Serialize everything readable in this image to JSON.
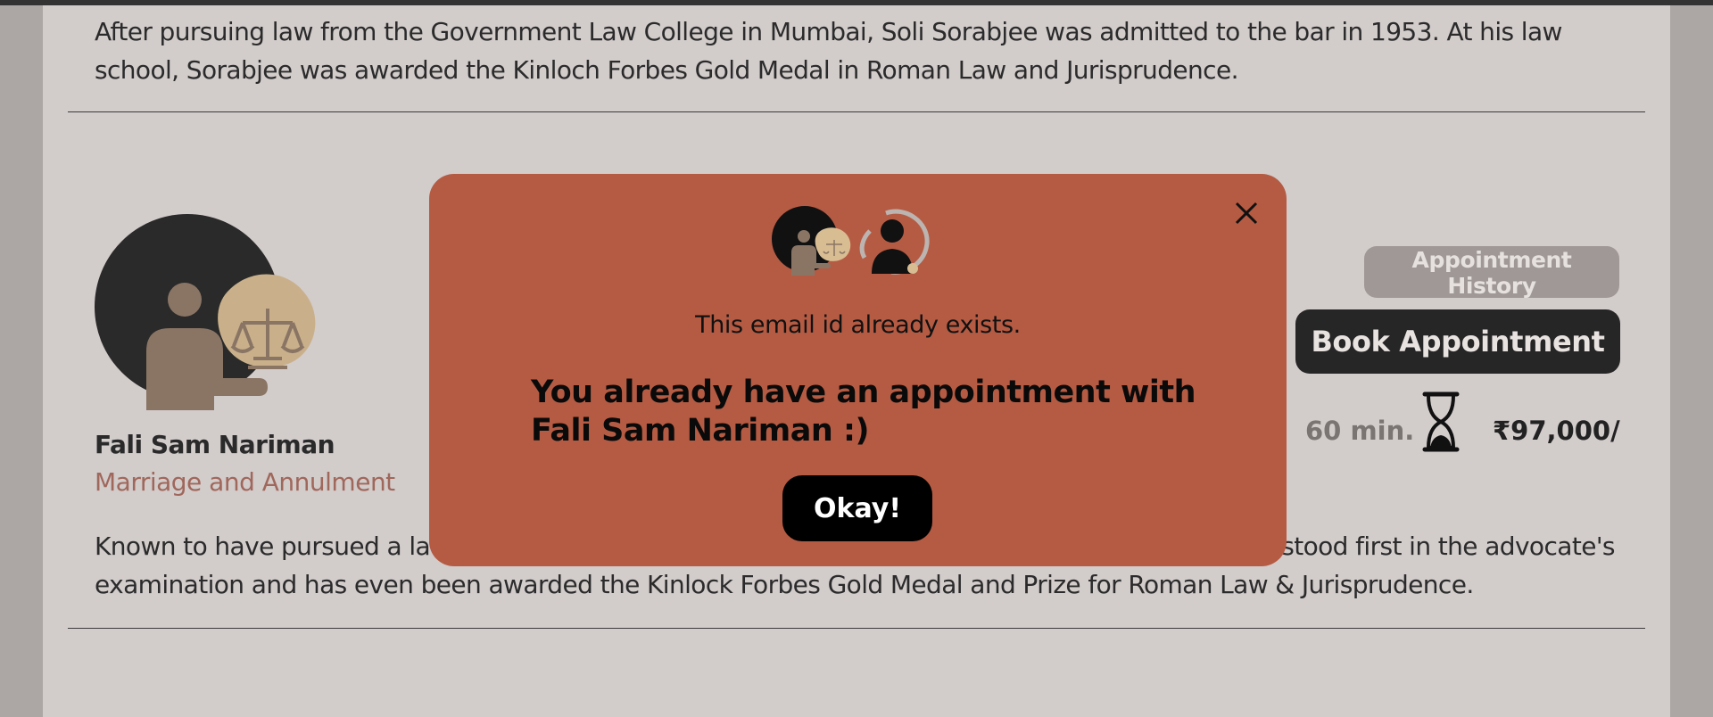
{
  "previous_lawyer": {
    "bio": "After pursuing law from the Government Law College in Mumbai, Soli Sorabjee was admitted to the bar in 1953. At his law school, Sorabjee was awarded the Kinloch Forbes Gold Medal in Roman Law and Jurisprudence."
  },
  "lawyer": {
    "name": "Fali Sam Nariman",
    "specialization": "Marriage and Annulment",
    "bio": "Known to have pursued a law degree from Government Law College in Mumbai, Fali Sam Nariman stood first in the advocate's examination and has even been awarded the Kinlock Forbes Gold Medal and Prize for Roman Law & Jurisprudence.",
    "duration": "60 min.",
    "price": "₹97,000/",
    "history_label": "Appointment History",
    "book_label": "Book Appointment"
  },
  "modal": {
    "message": "This email id already exists.",
    "title": "You already have an appointment with Fali Sam Nariman :)",
    "okay_label": "Okay!"
  },
  "colors": {
    "background": "#aca7a4",
    "panel": "#d2cccb",
    "modal": "#b55b43",
    "accent_text": "#a0675b",
    "dark_button": "#262626"
  },
  "icons": [
    "lawyer-avatar-icon",
    "scales-icon",
    "user-silhouette-icon",
    "hourglass-icon",
    "close-icon"
  ]
}
